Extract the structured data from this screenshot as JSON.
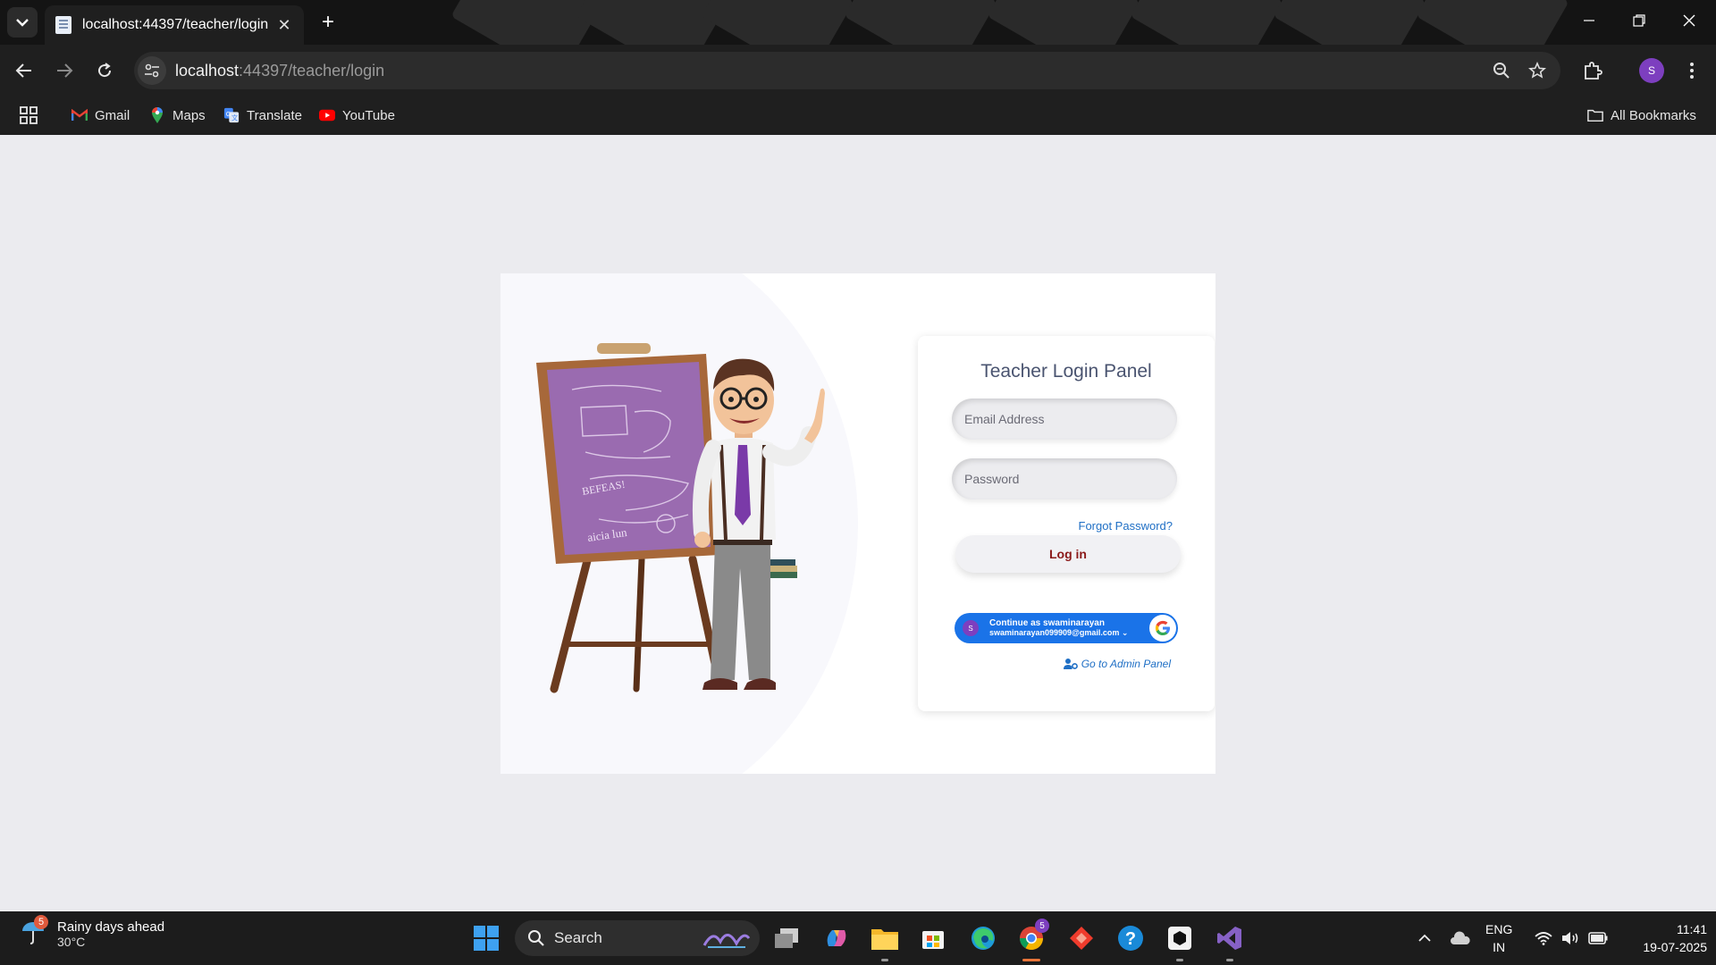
{
  "browser": {
    "tab_title": "localhost:44397/teacher/login",
    "url_host": "localhost",
    "url_rest": ":44397/teacher/login",
    "profile_initial": "S"
  },
  "bookmarks": {
    "items": [
      {
        "label": "Gmail",
        "icon": "gmail-icon"
      },
      {
        "label": "Maps",
        "icon": "maps-icon"
      },
      {
        "label": "Translate",
        "icon": "translate-icon"
      },
      {
        "label": "YouTube",
        "icon": "youtube-icon"
      }
    ],
    "all_bookmarks": "All Bookmarks"
  },
  "login": {
    "title": "Teacher Login Panel",
    "email_placeholder": "Email Address",
    "password_placeholder": "Password",
    "forgot_label": "Forgot Password?",
    "login_label": "Log in",
    "google_name": "Continue as swaminarayan",
    "google_email": "swaminarayan099909@gmail.com",
    "google_initial": "S",
    "admin_link": "Go to Admin Panel"
  },
  "chalkboard": {
    "lines": [
      "BEFEAS!",
      "aicia lun"
    ]
  },
  "taskbar": {
    "weather_title": "Rainy days ahead",
    "weather_temp": "30°C",
    "weather_badge": "5",
    "search_label": "Search",
    "chrome_badge": "5",
    "lang_top": "ENG",
    "lang_bottom": "IN",
    "time": "11:41",
    "date": "19-07-2025"
  },
  "colors": {
    "accent_google": "#1a73e8",
    "login_text": "#8b1a1a",
    "link": "#1f6fc5",
    "chalkboard": "#9a6bb0"
  }
}
